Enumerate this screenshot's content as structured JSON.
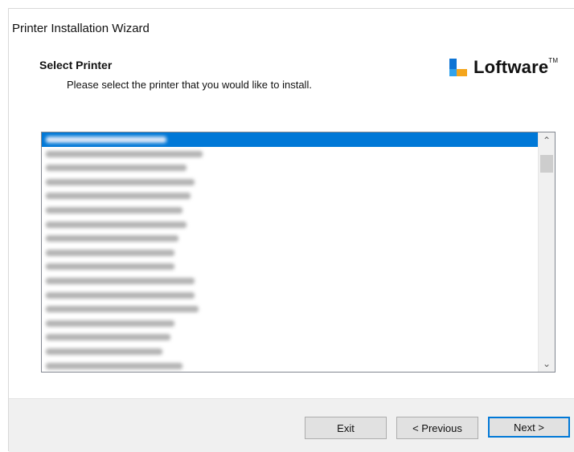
{
  "window": {
    "title": "Printer Installation Wizard"
  },
  "header": {
    "heading": "Select Printer",
    "subheading": "Please select the printer that you would like to install.",
    "logo_text": "Loftware",
    "logo_mark": "TM"
  },
  "printer_list": {
    "items": [
      {
        "selected": true
      },
      {
        "selected": false
      },
      {
        "selected": false
      },
      {
        "selected": false
      },
      {
        "selected": false
      },
      {
        "selected": false
      },
      {
        "selected": false
      },
      {
        "selected": false
      },
      {
        "selected": false
      },
      {
        "selected": false
      },
      {
        "selected": false
      },
      {
        "selected": false
      },
      {
        "selected": false
      },
      {
        "selected": false
      },
      {
        "selected": false
      },
      {
        "selected": false
      },
      {
        "selected": false
      }
    ]
  },
  "buttons": {
    "exit": "Exit",
    "previous": "< Previous",
    "next": "Next >"
  },
  "colors": {
    "selection": "#0078d7",
    "brand_dark_blue": "#0e74d4",
    "brand_light_blue": "#31a2ec",
    "brand_orange": "#f4a51c"
  }
}
